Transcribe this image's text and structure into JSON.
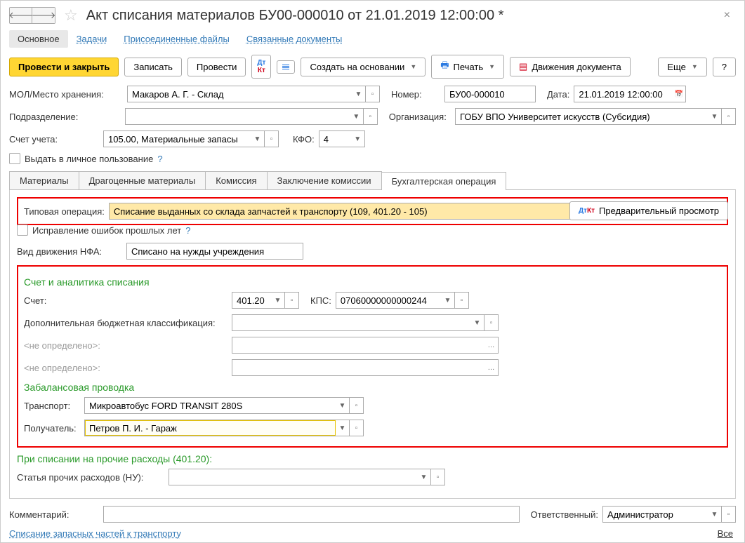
{
  "header": {
    "title": "Акт списания материалов БУ00-000010 от 21.01.2019 12:00:00 *"
  },
  "mainTabs": {
    "osnovnoe": "Основное",
    "zadachi": "Задачи",
    "files": "Присоединенные файлы",
    "related": "Связанные документы"
  },
  "toolbar": {
    "provesti_zakryt": "Провести и закрыть",
    "zapisat": "Записать",
    "provesti": "Провести",
    "create_based": "Создать на основании",
    "print": "Печать",
    "movements": "Движения документа",
    "more": "Еще",
    "help": "?"
  },
  "fields": {
    "mol_label": "МОЛ/Место хранения:",
    "mol_value": "Макаров А. Г. - Склад",
    "nomer_label": "Номер:",
    "nomer_value": "БУ00-000010",
    "data_label": "Дата:",
    "data_value": "21.01.2019 12:00:00",
    "podrazdelenie_label": "Подразделение:",
    "podrazdelenie_value": "",
    "org_label": "Организация:",
    "org_value": "ГОБУ ВПО Университет искусств (Субсидия)",
    "schet_ucheta_label": "Счет учета:",
    "schet_ucheta_value": "105.00, Материальные запасы",
    "kfo_label": "КФО:",
    "kfo_value": "4",
    "personal_use": "Выдать в личное пользование",
    "question": "?"
  },
  "subtabs": {
    "materialy": "Материалы",
    "drag": "Драгоценные материалы",
    "komissia": "Комиссия",
    "zakl": "Заключение комиссии",
    "buh": "Бухгалтерская операция"
  },
  "operation": {
    "label": "Типовая операция:",
    "value": "Списание выданных со склада запчастей к транспорту (109, 401.20 - 105)",
    "preview": "Предварительный просмотр",
    "fix_errors": "Исправление ошибок прошлых лет",
    "fix_q": "?",
    "vid_label": "Вид движения НФА:",
    "vid_value": "Списано на нужды учреждения"
  },
  "section_analytics": {
    "title": "Счет и аналитика списания",
    "schet_label": "Счет:",
    "schet_value": "401.20",
    "kps_label": "КПС:",
    "kps_value": "07060000000000244",
    "dop_label": "Дополнительная бюджетная классификация:",
    "dop_value": "",
    "undef1": "<не определено>:",
    "undef2": "<не определено>:"
  },
  "section_zab": {
    "title": "Забалансовая проводка",
    "transport_label": "Транспорт:",
    "transport_value": "Микроавтобус FORD TRANSIT 280S",
    "recipient_label": "Получатель:",
    "recipient_value": "Петров П. И. - Гараж"
  },
  "section_other": {
    "title": "При списании на прочие расходы (401.20):",
    "article_label": "Статья прочих расходов (НУ):",
    "article_value": ""
  },
  "footer": {
    "comment_label": "Комментарий:",
    "comment_value": "",
    "resp_label": "Ответственный:",
    "resp_value": "Администратор",
    "link": "Списание запасных частей к транспорту",
    "all": "Все"
  }
}
